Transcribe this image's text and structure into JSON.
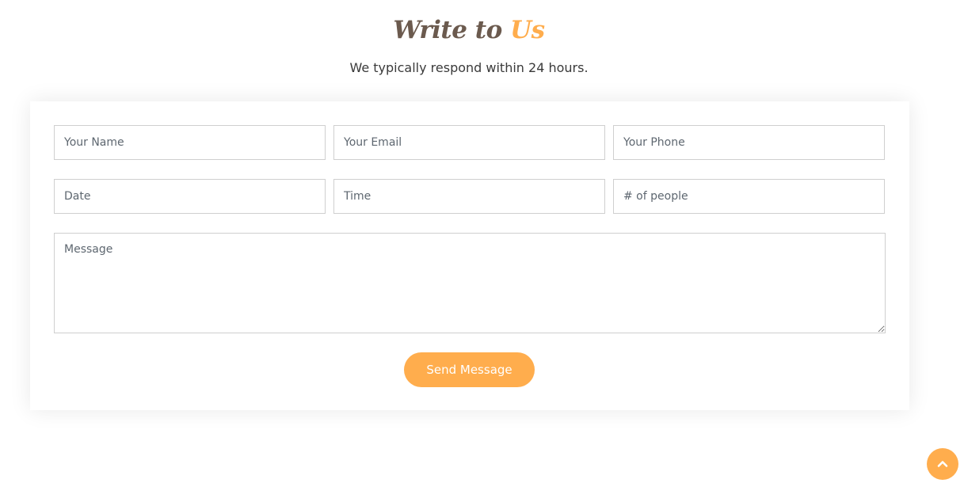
{
  "heading": {
    "part1": "Write to",
    "part2": "Us"
  },
  "subtitle": "We typically respond within 24 hours.",
  "form": {
    "name_placeholder": "Your Name",
    "email_placeholder": "Your Email",
    "phone_placeholder": "Your Phone",
    "date_placeholder": "Date",
    "time_placeholder": "Time",
    "people_placeholder": "# of people",
    "message_placeholder": "Message",
    "submit_label": "Send Message"
  },
  "colors": {
    "accent": "#ffad4d",
    "heading_dark": "#6b5a4e"
  },
  "icons": {
    "back_to_top": "chevron-up-icon"
  }
}
